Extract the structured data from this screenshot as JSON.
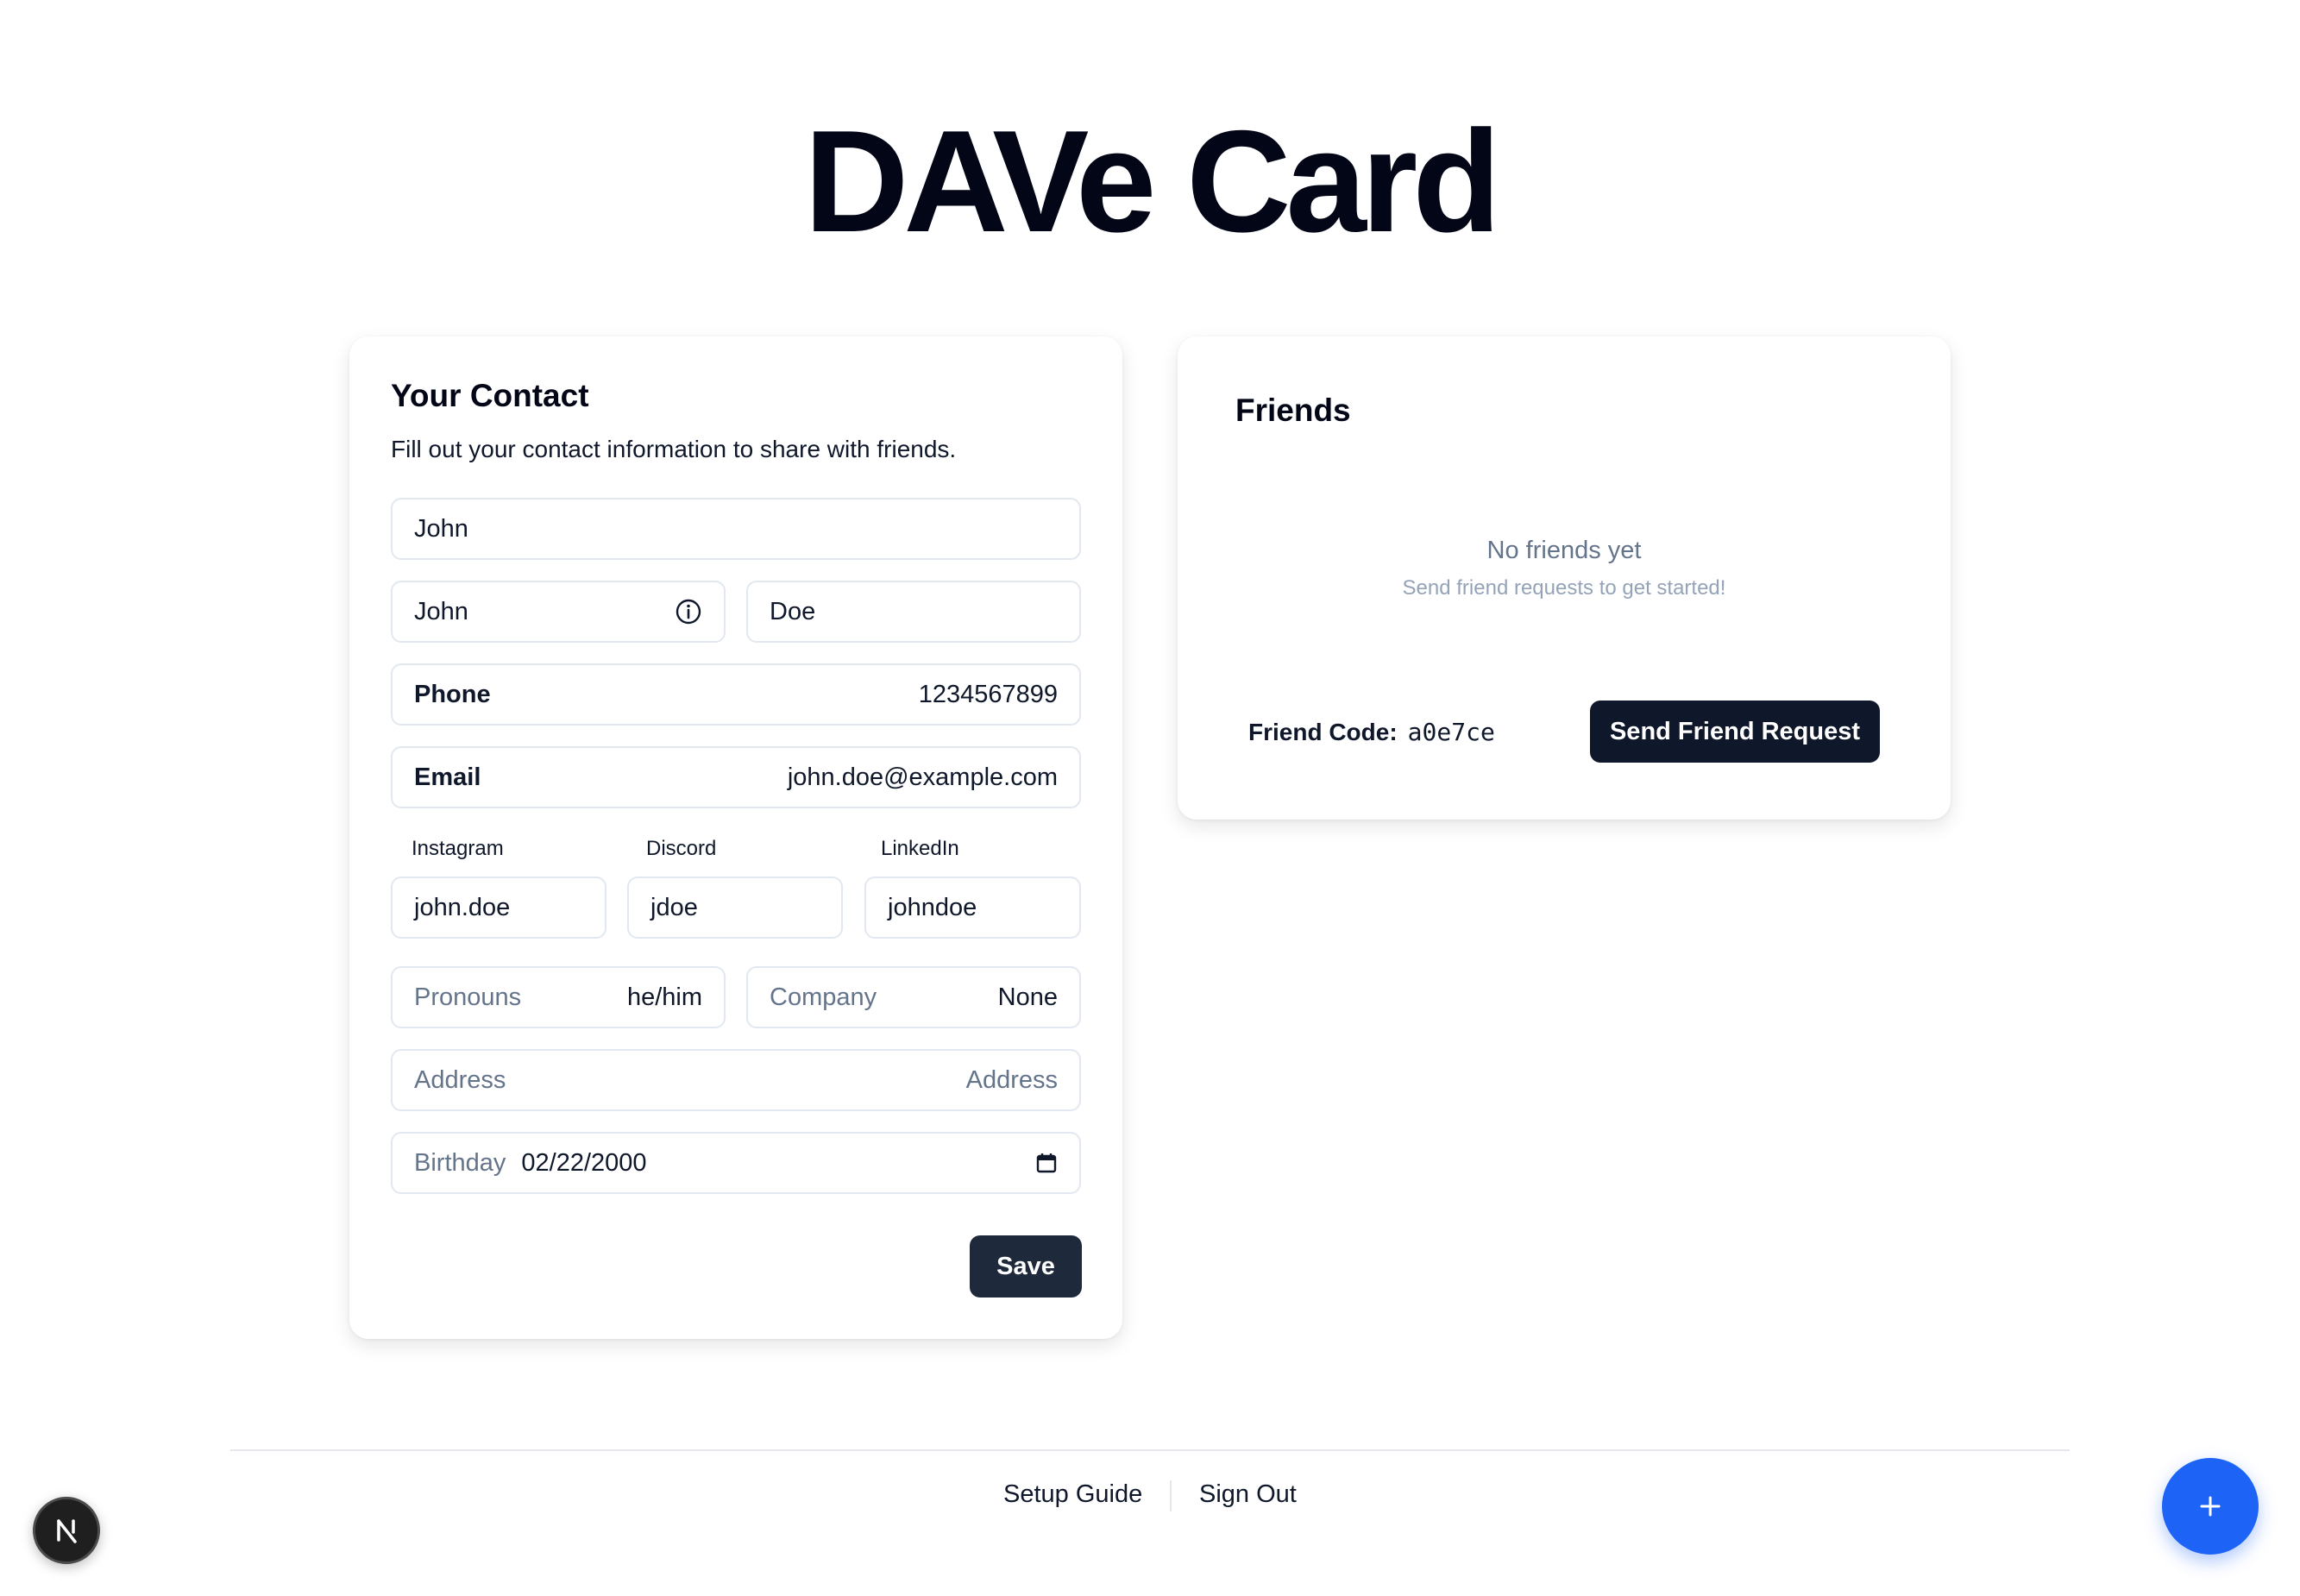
{
  "app": {
    "title": "DAVe Card"
  },
  "contact": {
    "heading": "Your Contact",
    "description": "Fill out your contact information to share with friends.",
    "display_name": "John",
    "first_name": "John",
    "last_name": "Doe",
    "phone": {
      "label": "Phone",
      "value": "1234567899"
    },
    "email": {
      "label": "Email",
      "value": "john.doe@example.com"
    },
    "social": {
      "instagram": {
        "label": "Instagram",
        "value": "john.doe"
      },
      "discord": {
        "label": "Discord",
        "value": "jdoe"
      },
      "linkedin": {
        "label": "LinkedIn",
        "value": "johndoe"
      }
    },
    "pronouns": {
      "label": "Pronouns",
      "value": "he/him"
    },
    "company": {
      "label": "Company",
      "value": "None"
    },
    "address": {
      "label": "Address",
      "placeholder": "Address"
    },
    "birthday": {
      "label": "Birthday",
      "value": "02/22/2000"
    },
    "save_label": "Save"
  },
  "friends": {
    "heading": "Friends",
    "empty_title": "No friends yet",
    "empty_subtitle": "Send friend requests to get started!",
    "code_label": "Friend Code:",
    "code_value": "a0e7ce",
    "send_request_label": "Send Friend Request"
  },
  "footer": {
    "setup_guide": "Setup Guide",
    "sign_out": "Sign Out"
  },
  "fab": {
    "icon": "plus-icon",
    "color": "#1d63f5"
  },
  "badge": {
    "letter": "N"
  }
}
